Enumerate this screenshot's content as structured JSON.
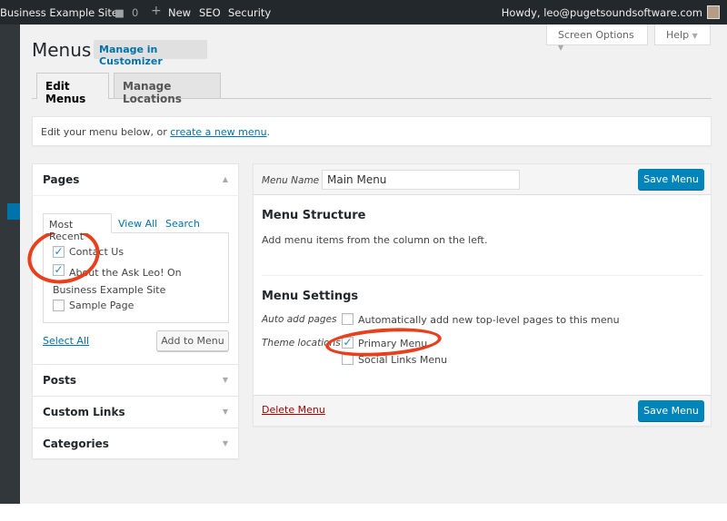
{
  "adminbar": {
    "site": "Business Example Site",
    "comments": "0",
    "new": "New",
    "seo": "SEO",
    "security": "Security",
    "howdy": "Howdy, leo@pugetsoundsoftware.com"
  },
  "header": {
    "title": "Menus",
    "customizer": "Manage in Customizer",
    "screen_options": "Screen Options",
    "help": "Help"
  },
  "tabs": [
    {
      "label": "Edit Menus",
      "active": true
    },
    {
      "label": "Manage Locations",
      "active": false
    }
  ],
  "notice": {
    "text": "Edit your menu below, or ",
    "link": "create a new menu",
    "end": "."
  },
  "left": {
    "pages_title": "Pages",
    "subtabs": [
      "Most Recent",
      "View All",
      "Search"
    ],
    "items": [
      {
        "label": "Contact Us",
        "checked": true
      },
      {
        "label": "About the Ask Leo! On Business Example Site",
        "checked": true
      },
      {
        "label": "Sample Page",
        "checked": false
      }
    ],
    "select_all": "Select All",
    "add_to_menu": "Add to Menu",
    "sections": [
      "Posts",
      "Custom Links",
      "Categories"
    ]
  },
  "right": {
    "menu_name_label": "Menu Name",
    "menu_name_value": "Main Menu",
    "save": "Save Menu",
    "structure_title": "Menu Structure",
    "structure_text": "Add menu items from the column on the left.",
    "settings_title": "Menu Settings",
    "auto_add_label": "Auto add pages",
    "auto_add_text": "Automatically add new top-level pages to this menu",
    "auto_add_checked": false,
    "theme_locations_label": "Theme locations",
    "locations": [
      {
        "label": "Primary Menu",
        "checked": true
      },
      {
        "label": "Social Links Menu",
        "checked": false
      }
    ],
    "delete": "Delete Menu"
  },
  "colors": {
    "adminbar": "#23282d",
    "primary": "#0085ba",
    "link": "#0073aa",
    "delete": "#a00",
    "highlight": "#e8401c"
  }
}
